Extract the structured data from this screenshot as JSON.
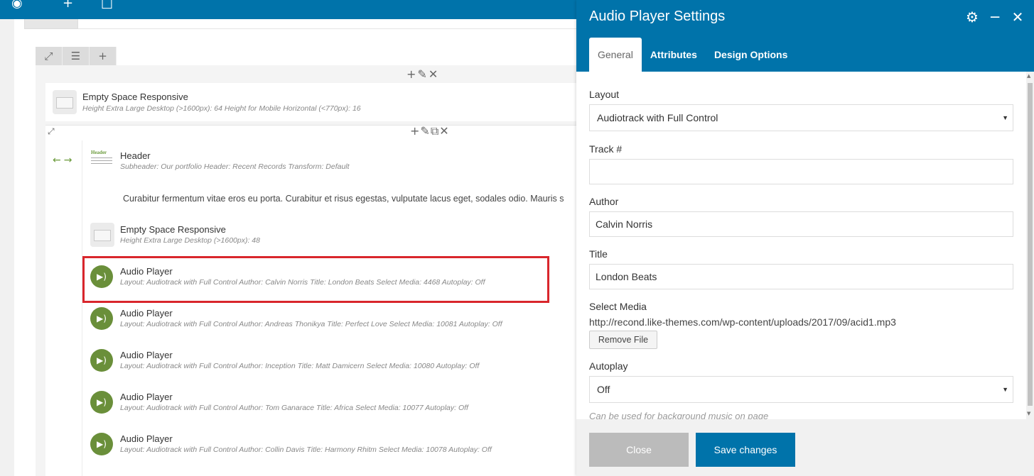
{
  "modal": {
    "title": "Audio Player Settings",
    "tabs": [
      {
        "label": "General"
      },
      {
        "label": "Attributes"
      },
      {
        "label": "Design Options"
      }
    ],
    "fields": {
      "layout": {
        "label": "Layout",
        "value": "Audiotrack with Full Control"
      },
      "track": {
        "label": "Track #",
        "value": ""
      },
      "author": {
        "label": "Author",
        "value": "Calvin Norris"
      },
      "title": {
        "label": "Title",
        "value": "London Beats"
      },
      "media": {
        "label": "Select Media",
        "url": "http://recond.like-themes.com/wp-content/uploads/2017/09/acid1.mp3",
        "remove_label": "Remove File"
      },
      "autoplay": {
        "label": "Autoplay",
        "value": "Off",
        "hint": "Can be used for background music on page"
      }
    },
    "close_label": "Close",
    "save_label": "Save changes"
  },
  "elements": [
    {
      "title": "Empty Space Responsive",
      "sub": "Height Extra Large Desktop (>1600px): 64  Height for Mobile Horizontal (<770px): 16"
    },
    {
      "title": "Header",
      "sub": "Subheader: Our portfolio  Header: Recent Records  Transform: Default"
    },
    {
      "title": "Empty Space Responsive",
      "sub": "Height Extra Large Desktop (>1600px): 48"
    },
    {
      "title": "Audio Player",
      "sub": "Layout: Audiotrack with Full Control  Author: Calvin Norris  Title: London Beats  Select Media: 4468  Autoplay: Off"
    },
    {
      "title": "Audio Player",
      "sub": "Layout: Audiotrack with Full Control  Author: Andreas Thonikya  Title: Perfect Love  Select Media: 10081  Autoplay: Off"
    },
    {
      "title": "Audio Player",
      "sub": "Layout: Audiotrack with Full Control  Author: Inception  Title: Matt Damicern  Select Media: 10080  Autoplay: Off"
    },
    {
      "title": "Audio Player",
      "sub": "Layout: Audiotrack with Full Control  Author: Tom Ganarace  Title: Africa  Select Media: 10077  Autoplay: Off"
    },
    {
      "title": "Audio Player",
      "sub": "Layout: Audiotrack with Full Control  Author: Collin Davis  Title: Harmony Rhitm  Select Media: 10078  Autoplay: Off"
    }
  ],
  "header_thumb_text": "Header",
  "text_block": "Curabitur fermentum vitae eros eu porta. Curabitur et risus egestas, vulputate lacus eget, sodales odio. Mauris s",
  "colors": {
    "admin_blue": "#0073aa",
    "audio_green": "#6a8f3a",
    "highlight_red": "#d9262c"
  }
}
